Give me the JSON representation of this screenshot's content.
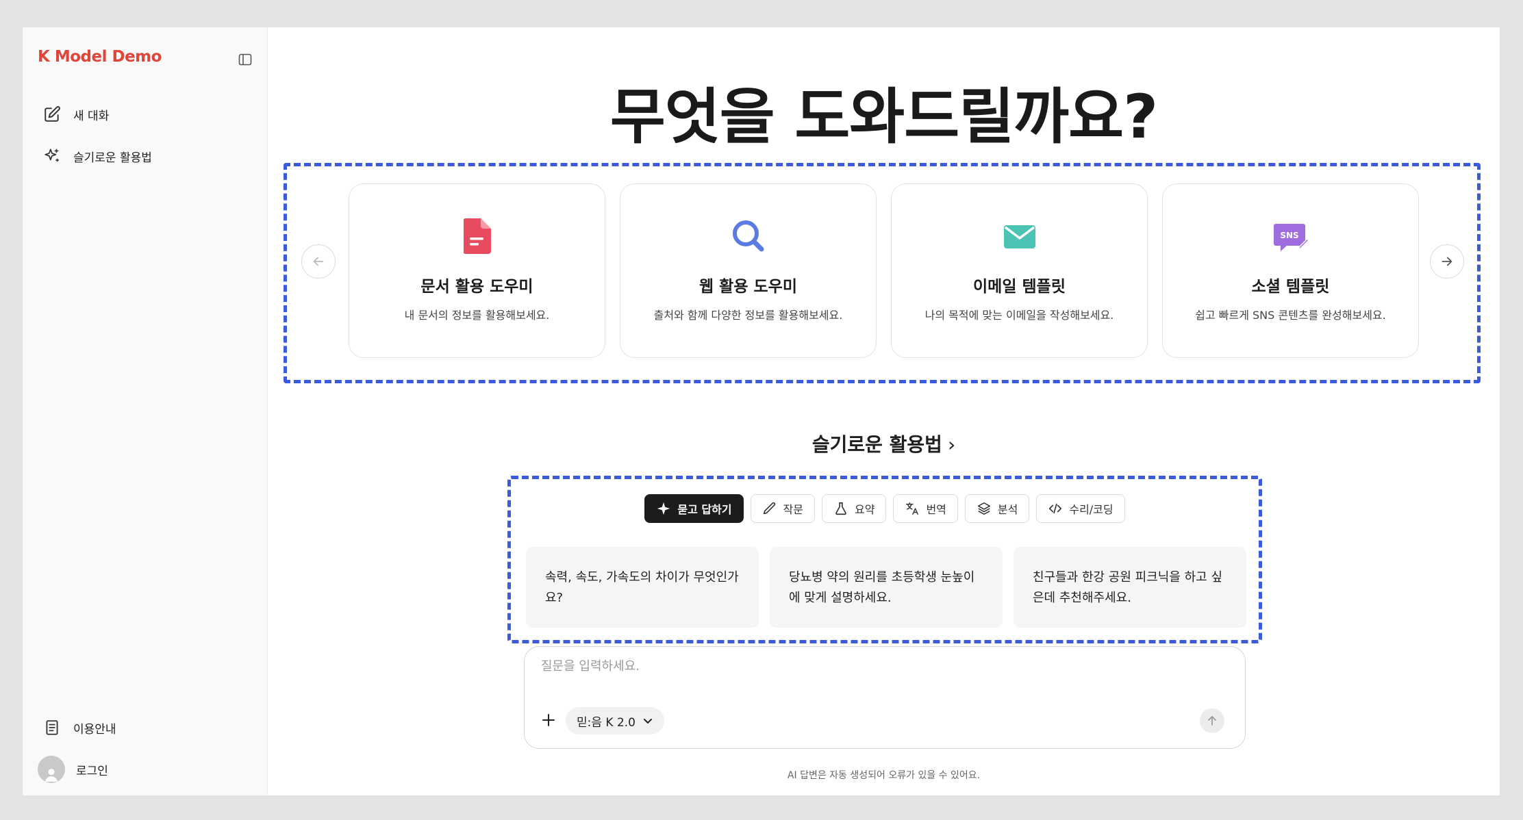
{
  "sidebar": {
    "brand": "K Model Demo",
    "nav": {
      "new_chat": "새 대화",
      "smart_usage": "슬기로운 활용법",
      "guide": "이용안내",
      "login": "로그인"
    }
  },
  "main": {
    "title": "무엇을 도와드릴까요?",
    "cards": [
      {
        "title": "문서 활용 도우미",
        "subtitle": "내 문서의 정보를 활용해보세요.",
        "icon": "document-icon",
        "color": "#e84a5f"
      },
      {
        "title": "웹 활용 도우미",
        "subtitle": "출처와 함께 다양한 정보를 활용해보세요.",
        "icon": "search-icon",
        "color": "#5b7be0"
      },
      {
        "title": "이메일 템플릿",
        "subtitle": "나의 목적에 맞는 이메일을 작성해보세요.",
        "icon": "mail-icon",
        "color": "#4cc4b5"
      },
      {
        "title": "소셜 템플릿",
        "subtitle": "쉽고 빠르게 SNS 콘텐츠를 완성해보세요.",
        "icon": "sns-icon",
        "color": "#a06de0",
        "icon_text": "SNS"
      }
    ],
    "smart_link": "슬기로운 활용법",
    "chips": [
      "묻고 답하기",
      "작문",
      "요약",
      "번역",
      "분석",
      "수리/코딩"
    ],
    "samples": [
      "속력, 속도, 가속도의 차이가 무엇인가요?",
      "당뇨병 약의 원리를 초등학생 눈높이에 맞게 설명하세요.",
      "친구들과 한강 공원 피크닉을 하고 싶은데 추천해주세요."
    ],
    "input": {
      "placeholder": "질문을 입력하세요.",
      "model": "믿:음 K 2.0"
    },
    "disclaimer": "AI 답변은 자동 생성되어 오류가 있을 수 있어요."
  }
}
